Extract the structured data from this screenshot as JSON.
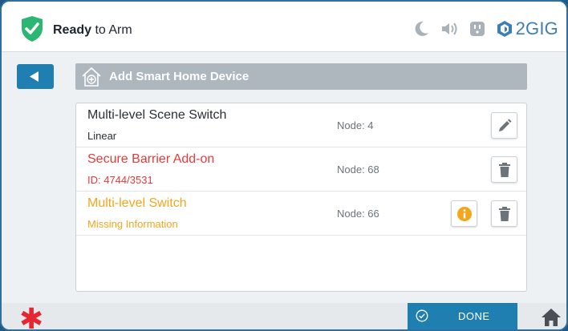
{
  "status": {
    "bold": "Ready",
    "rest": " to Arm"
  },
  "brand": {
    "logo_text": "2GIG"
  },
  "header": {
    "title": "Add Smart Home Device"
  },
  "devices": [
    {
      "name": "Multi-level Scene Switch",
      "subtitle": "Linear",
      "node": "Node: 4",
      "state": "default",
      "actions": [
        "edit-icon"
      ]
    },
    {
      "name": "Secure Barrier Add-on",
      "subtitle": "ID: 4744/3531",
      "node": "Node: 68",
      "state": "error",
      "actions": [
        "trash-icon"
      ]
    },
    {
      "name": "Multi-level Switch",
      "subtitle": "Missing Information",
      "node": "Node: 66",
      "state": "warning",
      "actions": [
        "info-icon",
        "trash-icon"
      ]
    }
  ],
  "footer": {
    "done_label": "DONE"
  },
  "colors": {
    "accent": "#1f7fb1",
    "ready_green": "#2bb673",
    "error": "#e33a3a",
    "warning": "#f3a61c",
    "alert_asterisk": "#e62733"
  },
  "icons": [
    "shield-check-icon",
    "moon-icon",
    "speaker-icon",
    "outlet-icon",
    "brand-logo-icon",
    "back-arrow-icon",
    "add-device-house-icon",
    "edit-icon",
    "trash-icon",
    "info-icon",
    "check-circle-icon",
    "home-icon",
    "asterisk-icon"
  ]
}
